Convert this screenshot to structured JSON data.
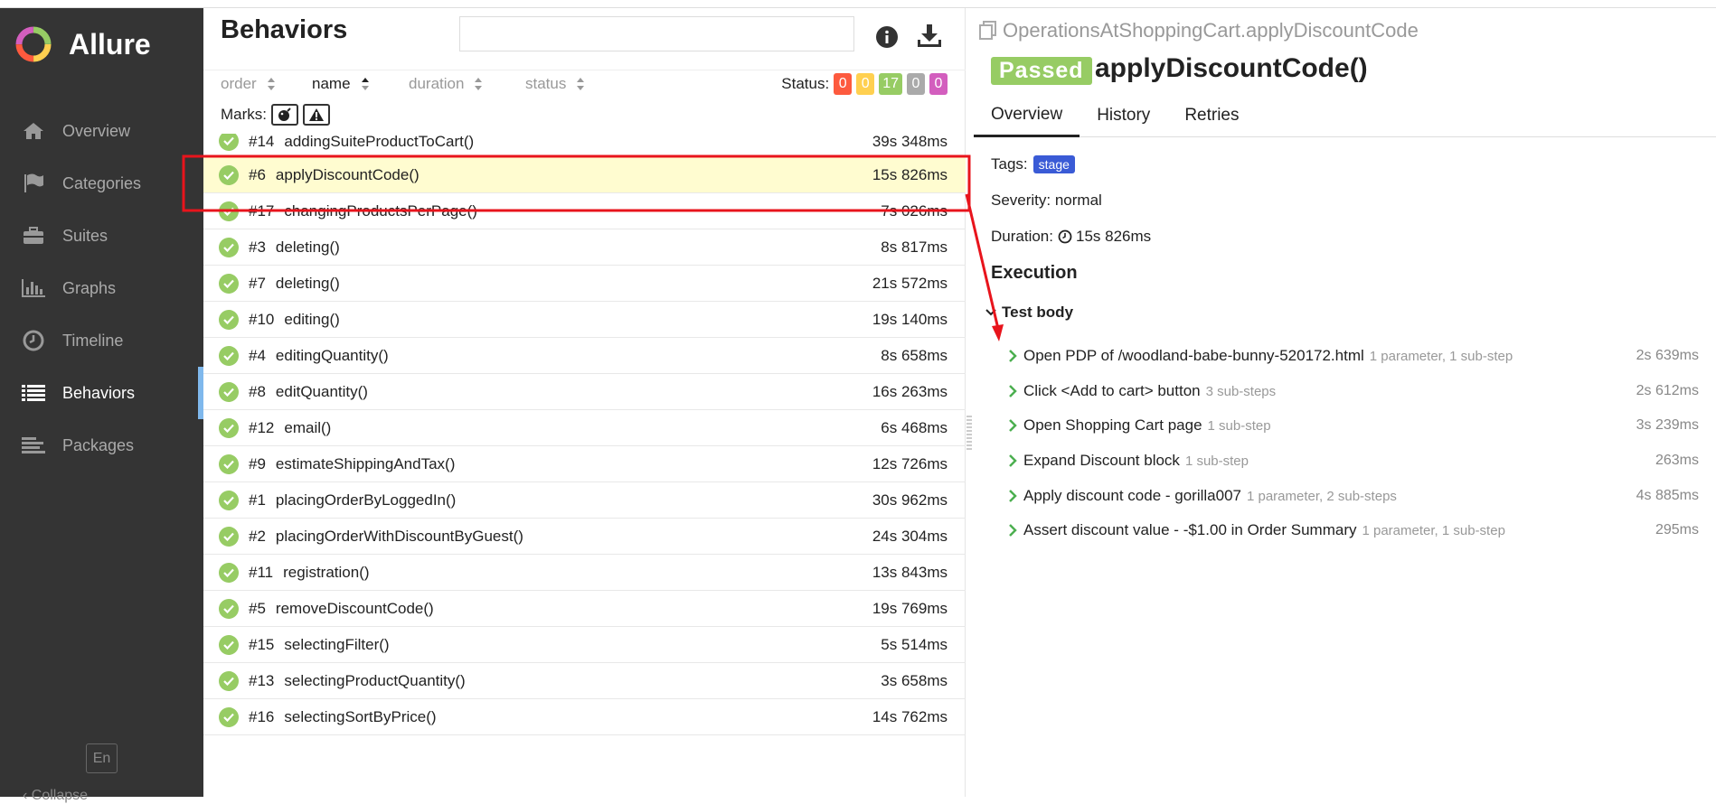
{
  "app": {
    "name": "Allure"
  },
  "sidebar": {
    "items": [
      {
        "label": "Overview",
        "icon": "home-icon"
      },
      {
        "label": "Categories",
        "icon": "flag-icon"
      },
      {
        "label": "Suites",
        "icon": "briefcase-icon"
      },
      {
        "label": "Graphs",
        "icon": "bar-chart-icon"
      },
      {
        "label": "Timeline",
        "icon": "clock-icon"
      },
      {
        "label": "Behaviors",
        "icon": "list-icon",
        "active": true
      },
      {
        "label": "Packages",
        "icon": "align-left-icon"
      }
    ],
    "lang": "En",
    "collapse_label": "Collapse"
  },
  "behaviors": {
    "title": "Behaviors",
    "search_value": "",
    "sort": {
      "order": "order",
      "name": "name",
      "duration": "duration",
      "status": "status"
    },
    "status_label": "Status:",
    "status_counts": [
      {
        "value": "0",
        "color": "#fd5a3e"
      },
      {
        "value": "0",
        "color": "#ffd050"
      },
      {
        "value": "17",
        "color": "#97cc64"
      },
      {
        "value": "0",
        "color": "#aaaaaa"
      },
      {
        "value": "0",
        "color": "#d35ebe"
      }
    ],
    "marks_label": "Marks:",
    "rows": [
      {
        "num": "#14",
        "name": "addingSuiteProductToCart()",
        "dur": "39s 348ms"
      },
      {
        "num": "#6",
        "name": "applyDiscountCode()",
        "dur": "15s 826ms",
        "selected": true
      },
      {
        "num": "#17",
        "name": "changingProductsPerPage()",
        "dur": "7s 026ms"
      },
      {
        "num": "#3",
        "name": "deleting()",
        "dur": "8s 817ms"
      },
      {
        "num": "#7",
        "name": "deleting()",
        "dur": "21s 572ms"
      },
      {
        "num": "#10",
        "name": "editing()",
        "dur": "19s 140ms"
      },
      {
        "num": "#4",
        "name": "editingQuantity()",
        "dur": "8s 658ms"
      },
      {
        "num": "#8",
        "name": "editQuantity()",
        "dur": "16s 263ms"
      },
      {
        "num": "#12",
        "name": "email()",
        "dur": "6s 468ms"
      },
      {
        "num": "#9",
        "name": "estimateShippingAndTax()",
        "dur": "12s 726ms"
      },
      {
        "num": "#1",
        "name": "placingOrderByLoggedIn()",
        "dur": "30s 962ms"
      },
      {
        "num": "#2",
        "name": "placingOrderWithDiscountByGuest()",
        "dur": "24s 304ms"
      },
      {
        "num": "#11",
        "name": "registration()",
        "dur": "13s 843ms"
      },
      {
        "num": "#5",
        "name": "removeDiscountCode()",
        "dur": "19s 769ms"
      },
      {
        "num": "#15",
        "name": "selectingFilter()",
        "dur": "5s 514ms"
      },
      {
        "num": "#13",
        "name": "selectingProductQuantity()",
        "dur": "3s 658ms"
      },
      {
        "num": "#16",
        "name": "selectingSortByPrice()",
        "dur": "14s 762ms"
      }
    ]
  },
  "detail": {
    "breadcrumb": "OperationsAtShoppingCart.applyDiscountCode",
    "status": "Passed",
    "title": "applyDiscountCode()",
    "tabs": [
      "Overview",
      "History",
      "Retries"
    ],
    "tags_label": "Tags:",
    "tag": "stage",
    "severity": "Severity: normal",
    "duration_label": "Duration:",
    "duration": "15s 826ms",
    "execution_heading": "Execution",
    "test_body": "Test body",
    "steps": [
      {
        "name": "Open PDP of /woodland-babe-bunny-520172.html",
        "sub": "1 parameter, 1 sub-step",
        "dur": "2s 639ms"
      },
      {
        "name": "Click <Add to cart> button",
        "sub": "3 sub-steps",
        "dur": "2s 612ms"
      },
      {
        "name": "Open Shopping Cart page",
        "sub": "1 sub-step",
        "dur": "3s 239ms"
      },
      {
        "name": "Expand Discount block",
        "sub": "1 sub-step",
        "dur": "263ms"
      },
      {
        "name": "Apply discount code - gorilla007",
        "sub": "1 parameter, 2 sub-steps",
        "dur": "4s 885ms"
      },
      {
        "name": "Assert discount value - -$1.00 in Order Summary",
        "sub": "1 parameter, 1 sub-step",
        "dur": "295ms"
      }
    ]
  },
  "colors": {
    "accent_red": "#e8141c",
    "passed": "#97cc64",
    "tag": "#3a5bd6"
  }
}
